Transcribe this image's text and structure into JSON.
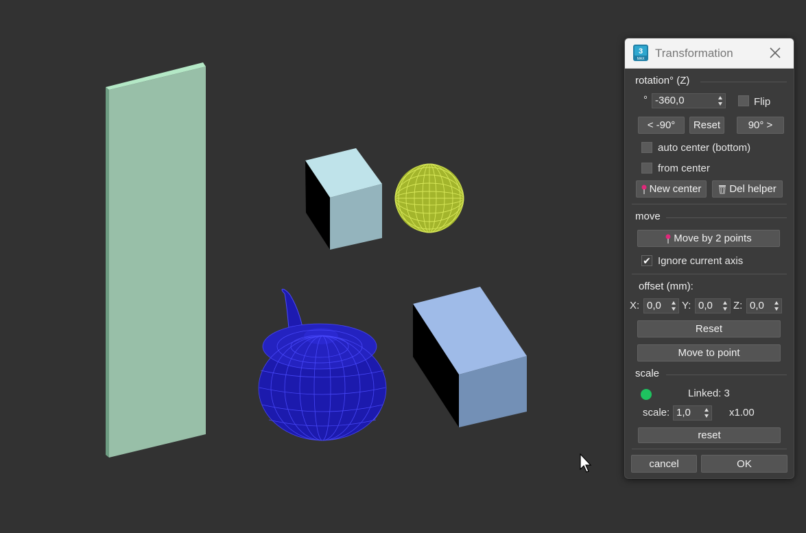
{
  "dialog": {
    "title": "Transformation",
    "app_icon": {
      "name": "3ds-max-icon",
      "text": "3",
      "subtext": "MAX"
    },
    "rotation": {
      "label": "rotation° (Z)",
      "degree_symbol": "°",
      "value": "-360,0",
      "flip_label": "Flip",
      "minus90_label": "< -90°",
      "reset_label": "Reset",
      "plus90_label": "90° >",
      "auto_center_label": "auto center (bottom)",
      "from_center_label": "from  center",
      "new_center_label": "New center",
      "del_helper_label": "Del helper"
    },
    "move": {
      "label": "move",
      "move2_label": "Move by 2 points",
      "ignore_axis_label": "Ignore current axis",
      "ignore_axis_checked": true,
      "checkmark": "✔"
    },
    "offset": {
      "label": "offset (mm):",
      "x_label": "X:",
      "x_value": "0,0",
      "y_label": "Y:",
      "y_value": "0,0",
      "z_label": "Z:",
      "z_value": "0,0",
      "reset_label": "Reset",
      "move_to_point_label": "Move to point"
    },
    "scale": {
      "label": "scale",
      "linked_label": "Linked: 3",
      "status_color": "#1ec25f",
      "scale_label": "scale:",
      "scale_value": "1,0",
      "multiplier": "x1.00",
      "reset_label": "reset"
    },
    "footer": {
      "cancel_label": "cancel",
      "ok_label": "OK"
    }
  },
  "colors": {
    "viewport_bg": "#323232",
    "panel_bg": "#3b3b3b",
    "button_bg": "#545454",
    "pin_color": "#e0287a"
  }
}
